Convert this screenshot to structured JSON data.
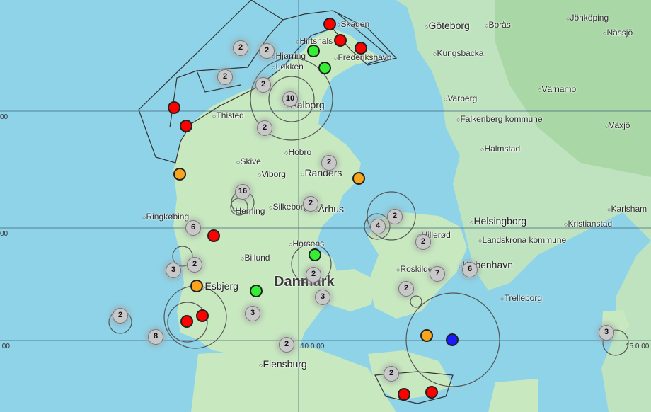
{
  "map": {
    "country_label": "Danmark",
    "cities": [
      {
        "name": "Göteborg",
        "big": true
      },
      {
        "name": "Borås"
      },
      {
        "name": "Jönköping"
      },
      {
        "name": "Nässjö"
      },
      {
        "name": "Kungsbacka"
      },
      {
        "name": "Varberg"
      },
      {
        "name": "Värnamo"
      },
      {
        "name": "Falkenberg kommune"
      },
      {
        "name": "Växjö"
      },
      {
        "name": "Halmstad"
      },
      {
        "name": "Karlsham"
      },
      {
        "name": "Kristianstad"
      },
      {
        "name": "Helsingborg",
        "big": true
      },
      {
        "name": "Landskrona kommune"
      },
      {
        "name": "København",
        "big": true
      },
      {
        "name": "Trelleborg"
      },
      {
        "name": "Skagen"
      },
      {
        "name": "Hirtshals"
      },
      {
        "name": "Frederikshavn"
      },
      {
        "name": "Hjørring"
      },
      {
        "name": "Løkken"
      },
      {
        "name": "Aalborg",
        "big": true
      },
      {
        "name": "Thisted"
      },
      {
        "name": "Hobro"
      },
      {
        "name": "Skive"
      },
      {
        "name": "Viborg"
      },
      {
        "name": "Randers",
        "big": true
      },
      {
        "name": "Herning"
      },
      {
        "name": "Silkeborg"
      },
      {
        "name": "Århus",
        "big": true
      },
      {
        "name": "Ringkøbing"
      },
      {
        "name": "Horsens"
      },
      {
        "name": "Billund"
      },
      {
        "name": "Esbjerg",
        "big": true
      },
      {
        "name": "Hillerød"
      },
      {
        "name": "Roskilde"
      },
      {
        "name": "Flensburg",
        "big": true
      }
    ],
    "grid_labels": [
      "00",
      "00",
      "10.0.00",
      "15.0.00",
      ".00"
    ],
    "clusters": [
      "2",
      "2",
      "2",
      "2",
      "10",
      "2",
      "2",
      "16",
      "2",
      "6",
      "2",
      "4",
      "2",
      "3",
      "2",
      "2",
      "3",
      "7",
      "6",
      "3",
      "2",
      "2",
      "8",
      "2",
      "2",
      "3"
    ],
    "marker_colors": {
      "red": "#ff0000",
      "green": "#33ee33",
      "orange": "#f8a51d",
      "blue": "#1a1aff"
    }
  }
}
